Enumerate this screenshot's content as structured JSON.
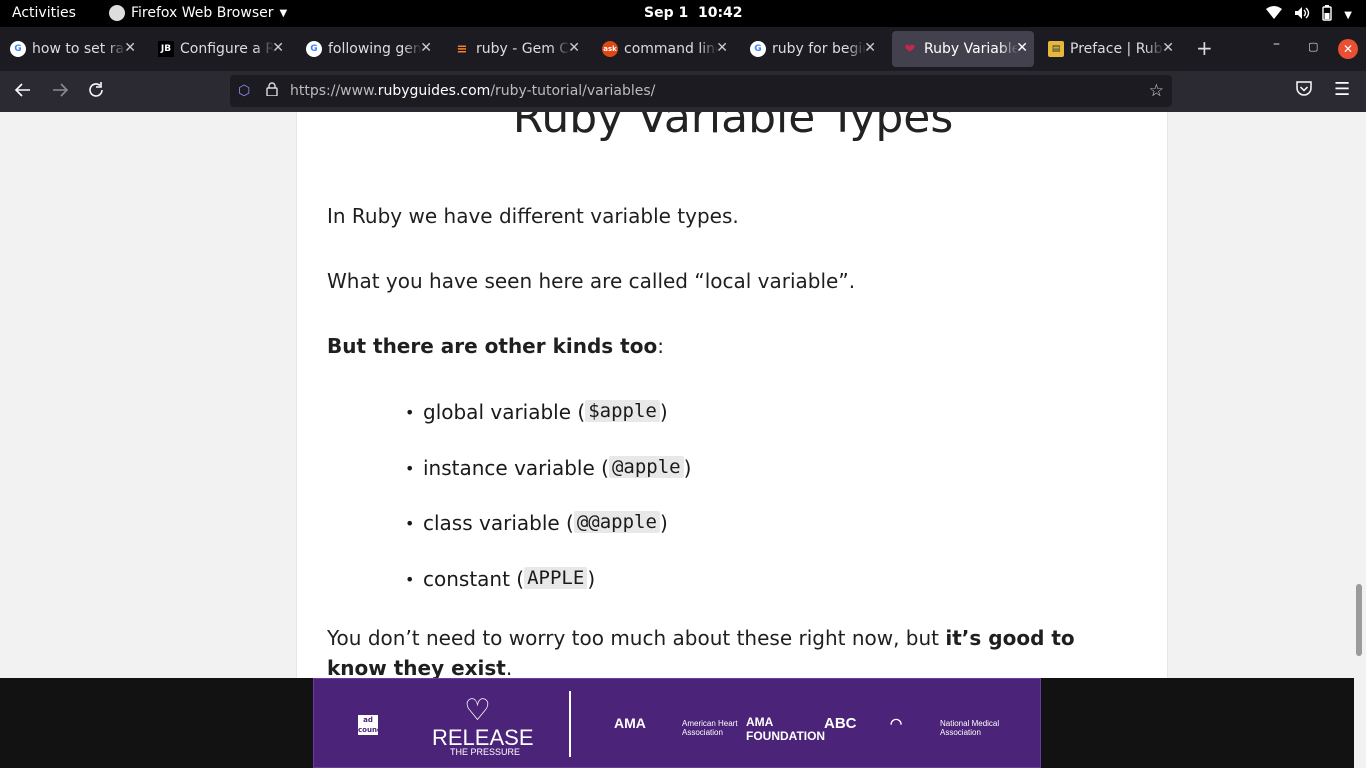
{
  "system_bar": {
    "activities": "Activities",
    "app_name": "Firefox Web Browser",
    "date": "Sep 1",
    "time": "10:42"
  },
  "tabs": [
    {
      "title": "how to set rai",
      "favicon": "google-icon",
      "favicon_color": "#ffffff",
      "active": false
    },
    {
      "title": "Configure a R",
      "favicon": "jetbrains-icon",
      "favicon_color": "#000000",
      "active": false
    },
    {
      "title": "following gen",
      "favicon": "google-icon",
      "favicon_color": "#ffffff",
      "active": false
    },
    {
      "title": "ruby - Gem Co",
      "favicon": "stackoverflow-icon",
      "favicon_color": "#f48024",
      "active": false
    },
    {
      "title": "command line",
      "favicon": "askubuntu-icon",
      "favicon_color": "#dd4814",
      "active": false
    },
    {
      "title": "ruby for begin",
      "favicon": "google-icon",
      "favicon_color": "#ffffff",
      "active": false
    },
    {
      "title": "Ruby Variable",
      "favicon": "rubyguides-icon",
      "favicon_color": "#b5244a",
      "active": true
    },
    {
      "title": "Preface | Ruby",
      "favicon": "book-icon",
      "favicon_color": "#e5b83c",
      "active": false
    }
  ],
  "address_bar": {
    "url_prefix": "https://www.",
    "url_domain": "rubyguides.com",
    "url_path": "/ruby-tutorial/variables/"
  },
  "article": {
    "heading": "Ruby Variable Types",
    "para1": "In Ruby we have different variable types.",
    "para2": "What you have seen here are called “local variable”.",
    "para3_bold": "But there are other kinds too",
    "para3_tail": ":",
    "list": [
      {
        "label": "global variable (",
        "code": "$apple",
        "close": ")"
      },
      {
        "label": "instance variable (",
        "code": "@apple",
        "close": ")"
      },
      {
        "label": "class variable (",
        "code": "@@apple",
        "close": ")"
      },
      {
        "label": "constant (",
        "code": "APPLE",
        "close": ")"
      }
    ],
    "para4_start": "You don’t need to worry too much about these right now, but ",
    "para4_bold": "it’s good to know they exist",
    "para4_end": "."
  },
  "ad": {
    "ad_council": "ad council",
    "release": "RELEASE",
    "pressure": "THE PRESSURE",
    "sponsors": [
      "AMA",
      "American Heart Association",
      "AMA FOUNDATION",
      "ABC",
      "National Medical Association"
    ]
  }
}
